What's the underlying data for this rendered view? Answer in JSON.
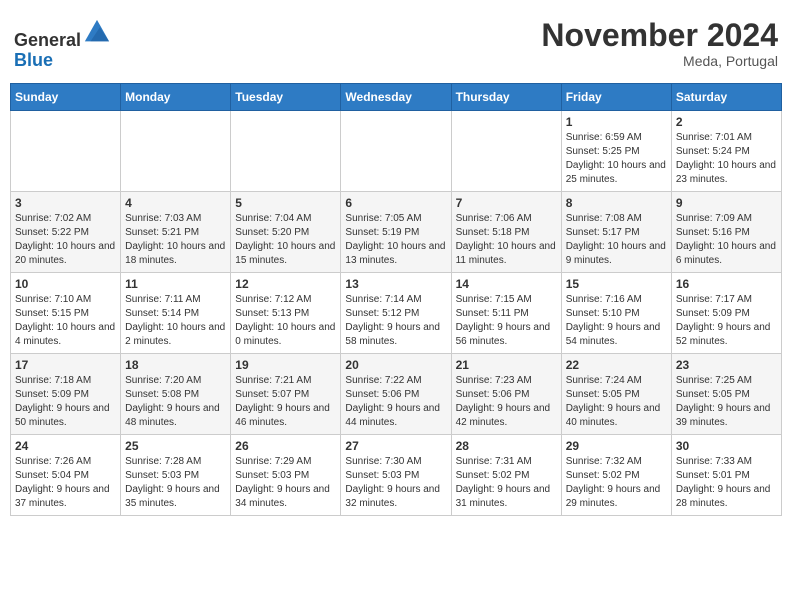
{
  "header": {
    "logo_line1": "General",
    "logo_line2": "Blue",
    "month": "November 2024",
    "location": "Meda, Portugal"
  },
  "weekdays": [
    "Sunday",
    "Monday",
    "Tuesday",
    "Wednesday",
    "Thursday",
    "Friday",
    "Saturday"
  ],
  "weeks": [
    [
      {
        "day": "",
        "info": ""
      },
      {
        "day": "",
        "info": ""
      },
      {
        "day": "",
        "info": ""
      },
      {
        "day": "",
        "info": ""
      },
      {
        "day": "",
        "info": ""
      },
      {
        "day": "1",
        "info": "Sunrise: 6:59 AM\nSunset: 5:25 PM\nDaylight: 10 hours and 25 minutes."
      },
      {
        "day": "2",
        "info": "Sunrise: 7:01 AM\nSunset: 5:24 PM\nDaylight: 10 hours and 23 minutes."
      }
    ],
    [
      {
        "day": "3",
        "info": "Sunrise: 7:02 AM\nSunset: 5:22 PM\nDaylight: 10 hours and 20 minutes."
      },
      {
        "day": "4",
        "info": "Sunrise: 7:03 AM\nSunset: 5:21 PM\nDaylight: 10 hours and 18 minutes."
      },
      {
        "day": "5",
        "info": "Sunrise: 7:04 AM\nSunset: 5:20 PM\nDaylight: 10 hours and 15 minutes."
      },
      {
        "day": "6",
        "info": "Sunrise: 7:05 AM\nSunset: 5:19 PM\nDaylight: 10 hours and 13 minutes."
      },
      {
        "day": "7",
        "info": "Sunrise: 7:06 AM\nSunset: 5:18 PM\nDaylight: 10 hours and 11 minutes."
      },
      {
        "day": "8",
        "info": "Sunrise: 7:08 AM\nSunset: 5:17 PM\nDaylight: 10 hours and 9 minutes."
      },
      {
        "day": "9",
        "info": "Sunrise: 7:09 AM\nSunset: 5:16 PM\nDaylight: 10 hours and 6 minutes."
      }
    ],
    [
      {
        "day": "10",
        "info": "Sunrise: 7:10 AM\nSunset: 5:15 PM\nDaylight: 10 hours and 4 minutes."
      },
      {
        "day": "11",
        "info": "Sunrise: 7:11 AM\nSunset: 5:14 PM\nDaylight: 10 hours and 2 minutes."
      },
      {
        "day": "12",
        "info": "Sunrise: 7:12 AM\nSunset: 5:13 PM\nDaylight: 10 hours and 0 minutes."
      },
      {
        "day": "13",
        "info": "Sunrise: 7:14 AM\nSunset: 5:12 PM\nDaylight: 9 hours and 58 minutes."
      },
      {
        "day": "14",
        "info": "Sunrise: 7:15 AM\nSunset: 5:11 PM\nDaylight: 9 hours and 56 minutes."
      },
      {
        "day": "15",
        "info": "Sunrise: 7:16 AM\nSunset: 5:10 PM\nDaylight: 9 hours and 54 minutes."
      },
      {
        "day": "16",
        "info": "Sunrise: 7:17 AM\nSunset: 5:09 PM\nDaylight: 9 hours and 52 minutes."
      }
    ],
    [
      {
        "day": "17",
        "info": "Sunrise: 7:18 AM\nSunset: 5:09 PM\nDaylight: 9 hours and 50 minutes."
      },
      {
        "day": "18",
        "info": "Sunrise: 7:20 AM\nSunset: 5:08 PM\nDaylight: 9 hours and 48 minutes."
      },
      {
        "day": "19",
        "info": "Sunrise: 7:21 AM\nSunset: 5:07 PM\nDaylight: 9 hours and 46 minutes."
      },
      {
        "day": "20",
        "info": "Sunrise: 7:22 AM\nSunset: 5:06 PM\nDaylight: 9 hours and 44 minutes."
      },
      {
        "day": "21",
        "info": "Sunrise: 7:23 AM\nSunset: 5:06 PM\nDaylight: 9 hours and 42 minutes."
      },
      {
        "day": "22",
        "info": "Sunrise: 7:24 AM\nSunset: 5:05 PM\nDaylight: 9 hours and 40 minutes."
      },
      {
        "day": "23",
        "info": "Sunrise: 7:25 AM\nSunset: 5:05 PM\nDaylight: 9 hours and 39 minutes."
      }
    ],
    [
      {
        "day": "24",
        "info": "Sunrise: 7:26 AM\nSunset: 5:04 PM\nDaylight: 9 hours and 37 minutes."
      },
      {
        "day": "25",
        "info": "Sunrise: 7:28 AM\nSunset: 5:03 PM\nDaylight: 9 hours and 35 minutes."
      },
      {
        "day": "26",
        "info": "Sunrise: 7:29 AM\nSunset: 5:03 PM\nDaylight: 9 hours and 34 minutes."
      },
      {
        "day": "27",
        "info": "Sunrise: 7:30 AM\nSunset: 5:03 PM\nDaylight: 9 hours and 32 minutes."
      },
      {
        "day": "28",
        "info": "Sunrise: 7:31 AM\nSunset: 5:02 PM\nDaylight: 9 hours and 31 minutes."
      },
      {
        "day": "29",
        "info": "Sunrise: 7:32 AM\nSunset: 5:02 PM\nDaylight: 9 hours and 29 minutes."
      },
      {
        "day": "30",
        "info": "Sunrise: 7:33 AM\nSunset: 5:01 PM\nDaylight: 9 hours and 28 minutes."
      }
    ]
  ]
}
